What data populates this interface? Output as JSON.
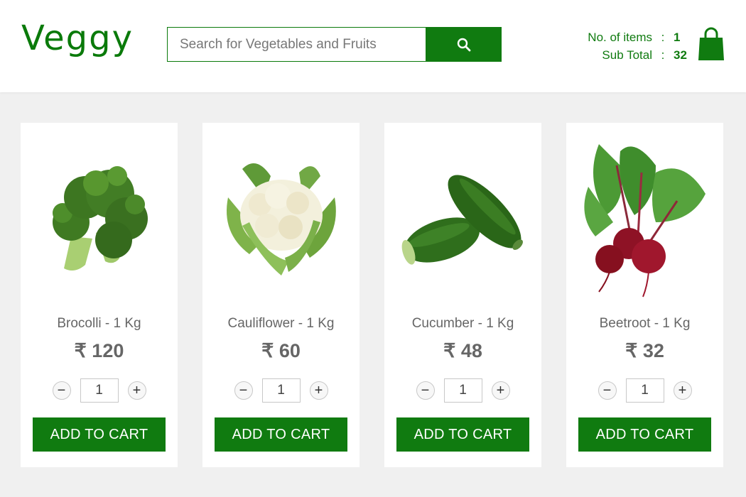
{
  "header": {
    "logo": "Veggy",
    "search": {
      "placeholder": "Search for Vegetables and Fruits",
      "value": ""
    },
    "cart": {
      "items_label": "No. of items",
      "items_value": "1",
      "subtotal_label": "Sub Total",
      "subtotal_value": "32",
      "separator": ":"
    }
  },
  "products": [
    {
      "name": "Brocolli - 1 Kg",
      "price": "₹ 120",
      "qty": "1",
      "add_label": "ADD TO CART",
      "image_icon": "broccoli-image"
    },
    {
      "name": "Cauliflower - 1 Kg",
      "price": "₹ 60",
      "qty": "1",
      "add_label": "ADD TO CART",
      "image_icon": "cauliflower-image"
    },
    {
      "name": "Cucumber - 1 Kg",
      "price": "₹ 48",
      "qty": "1",
      "add_label": "ADD TO CART",
      "image_icon": "cucumber-image"
    },
    {
      "name": "Beetroot - 1 Kg",
      "price": "₹ 32",
      "qty": "1",
      "add_label": "ADD TO CART",
      "image_icon": "beetroot-image"
    }
  ],
  "qty_controls": {
    "minus": "−",
    "plus": "+"
  },
  "colors": {
    "brand_green": "#107b10",
    "background": "#f0f0f0"
  }
}
